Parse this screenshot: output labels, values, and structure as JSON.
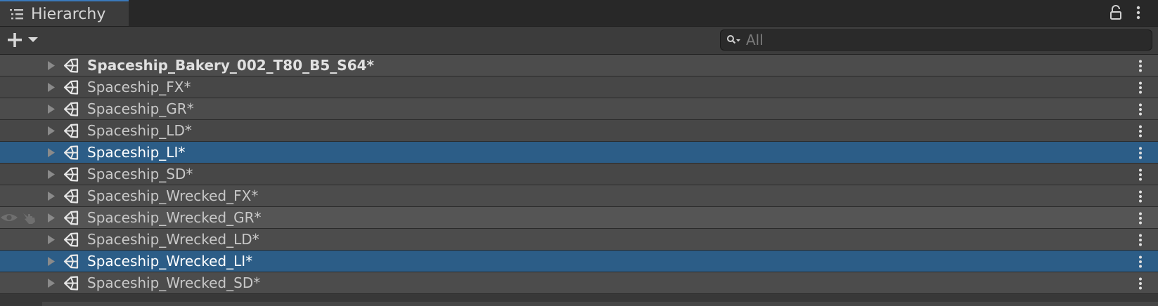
{
  "tab": {
    "title": "Hierarchy",
    "icon": "list-icon"
  },
  "header_icons": [
    "lock-icon",
    "kebab-menu-icon"
  ],
  "toolbar": {
    "create_icon": "plus-dropdown-icon",
    "search": {
      "icon": "search-dropdown-icon",
      "placeholder": "All",
      "value": ""
    }
  },
  "rows": [
    {
      "name": "Spaceship_Bakery_002_T80_B5_S64*",
      "bold": true,
      "selected": false
    },
    {
      "name": "Spaceship_FX*",
      "bold": false,
      "selected": false
    },
    {
      "name": "Spaceship_GR*",
      "bold": false,
      "selected": false
    },
    {
      "name": "Spaceship_LD*",
      "bold": false,
      "selected": false
    },
    {
      "name": "Spaceship_LI*",
      "bold": false,
      "selected": true
    },
    {
      "name": "Spaceship_SD*",
      "bold": false,
      "selected": false
    },
    {
      "name": "Spaceship_Wrecked_FX*",
      "bold": false,
      "selected": false
    },
    {
      "name": "Spaceship_Wrecked_GR*",
      "bold": false,
      "selected": false,
      "hover": true
    },
    {
      "name": "Spaceship_Wrecked_LD*",
      "bold": false,
      "selected": false
    },
    {
      "name": "Spaceship_Wrecked_LI*",
      "bold": false,
      "selected": true
    },
    {
      "name": "Spaceship_Wrecked_SD*",
      "bold": false,
      "selected": false
    }
  ],
  "colors": {
    "tab_accent": "#3a79bb",
    "selected_row": "#2c5d87",
    "row_bg": "#4c4c4c",
    "panel_bg": "#383838"
  }
}
